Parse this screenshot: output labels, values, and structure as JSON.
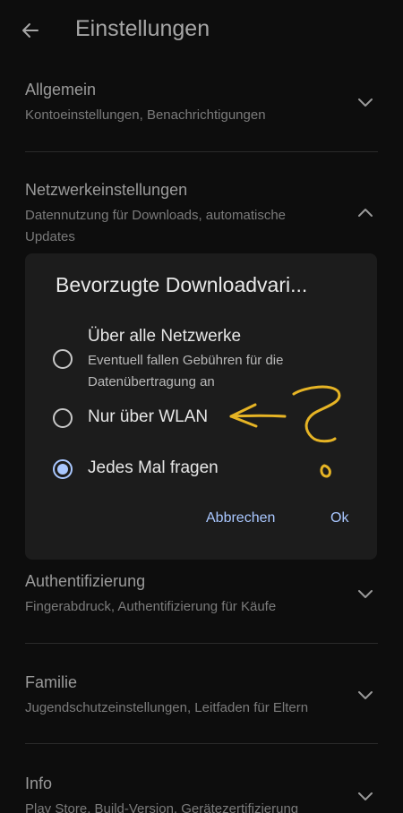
{
  "header": {
    "title": "Einstellungen",
    "back_icon": "arrow-left-icon"
  },
  "sections": [
    {
      "title": "Allgemein",
      "subtitle": "Kontoeinstellungen, Benachrichtigungen",
      "chevron": "chevron-down-icon"
    },
    {
      "title": "Netzwerkeinstellungen",
      "subtitle": "Datennutzung für Downloads, automatische Updates",
      "chevron": "chevron-up-icon"
    },
    {
      "title": "Authentifizierung",
      "subtitle": "Fingerabdruck, Authentifizierung für Käufe",
      "chevron": "chevron-down-icon"
    },
    {
      "title": "Familie",
      "subtitle": "Jugendschutzeinstellungen, Leitfaden für Eltern",
      "chevron": "chevron-down-icon"
    },
    {
      "title": "Info",
      "subtitle": "Play Store, Build-Version, Gerätezertifizierung",
      "chevron": "chevron-down-icon"
    }
  ],
  "dialog": {
    "title": "Bevorzugte Downloadvari...",
    "options": [
      {
        "label": "Über alle Netzwerke",
        "subtitle": "Eventuell fallen Gebühren für die Datenübertragung an",
        "selected": false
      },
      {
        "label": "Nur über WLAN",
        "subtitle": "",
        "selected": false
      },
      {
        "label": "Jedes Mal fragen",
        "subtitle": "",
        "selected": true
      }
    ],
    "cancel_label": "Abbrechen",
    "ok_label": "Ok"
  },
  "colors": {
    "background": "#0d0d0d",
    "dialog": "#1c1c1c",
    "accent": "#a9c7ff",
    "annotation": "#e6b425"
  }
}
